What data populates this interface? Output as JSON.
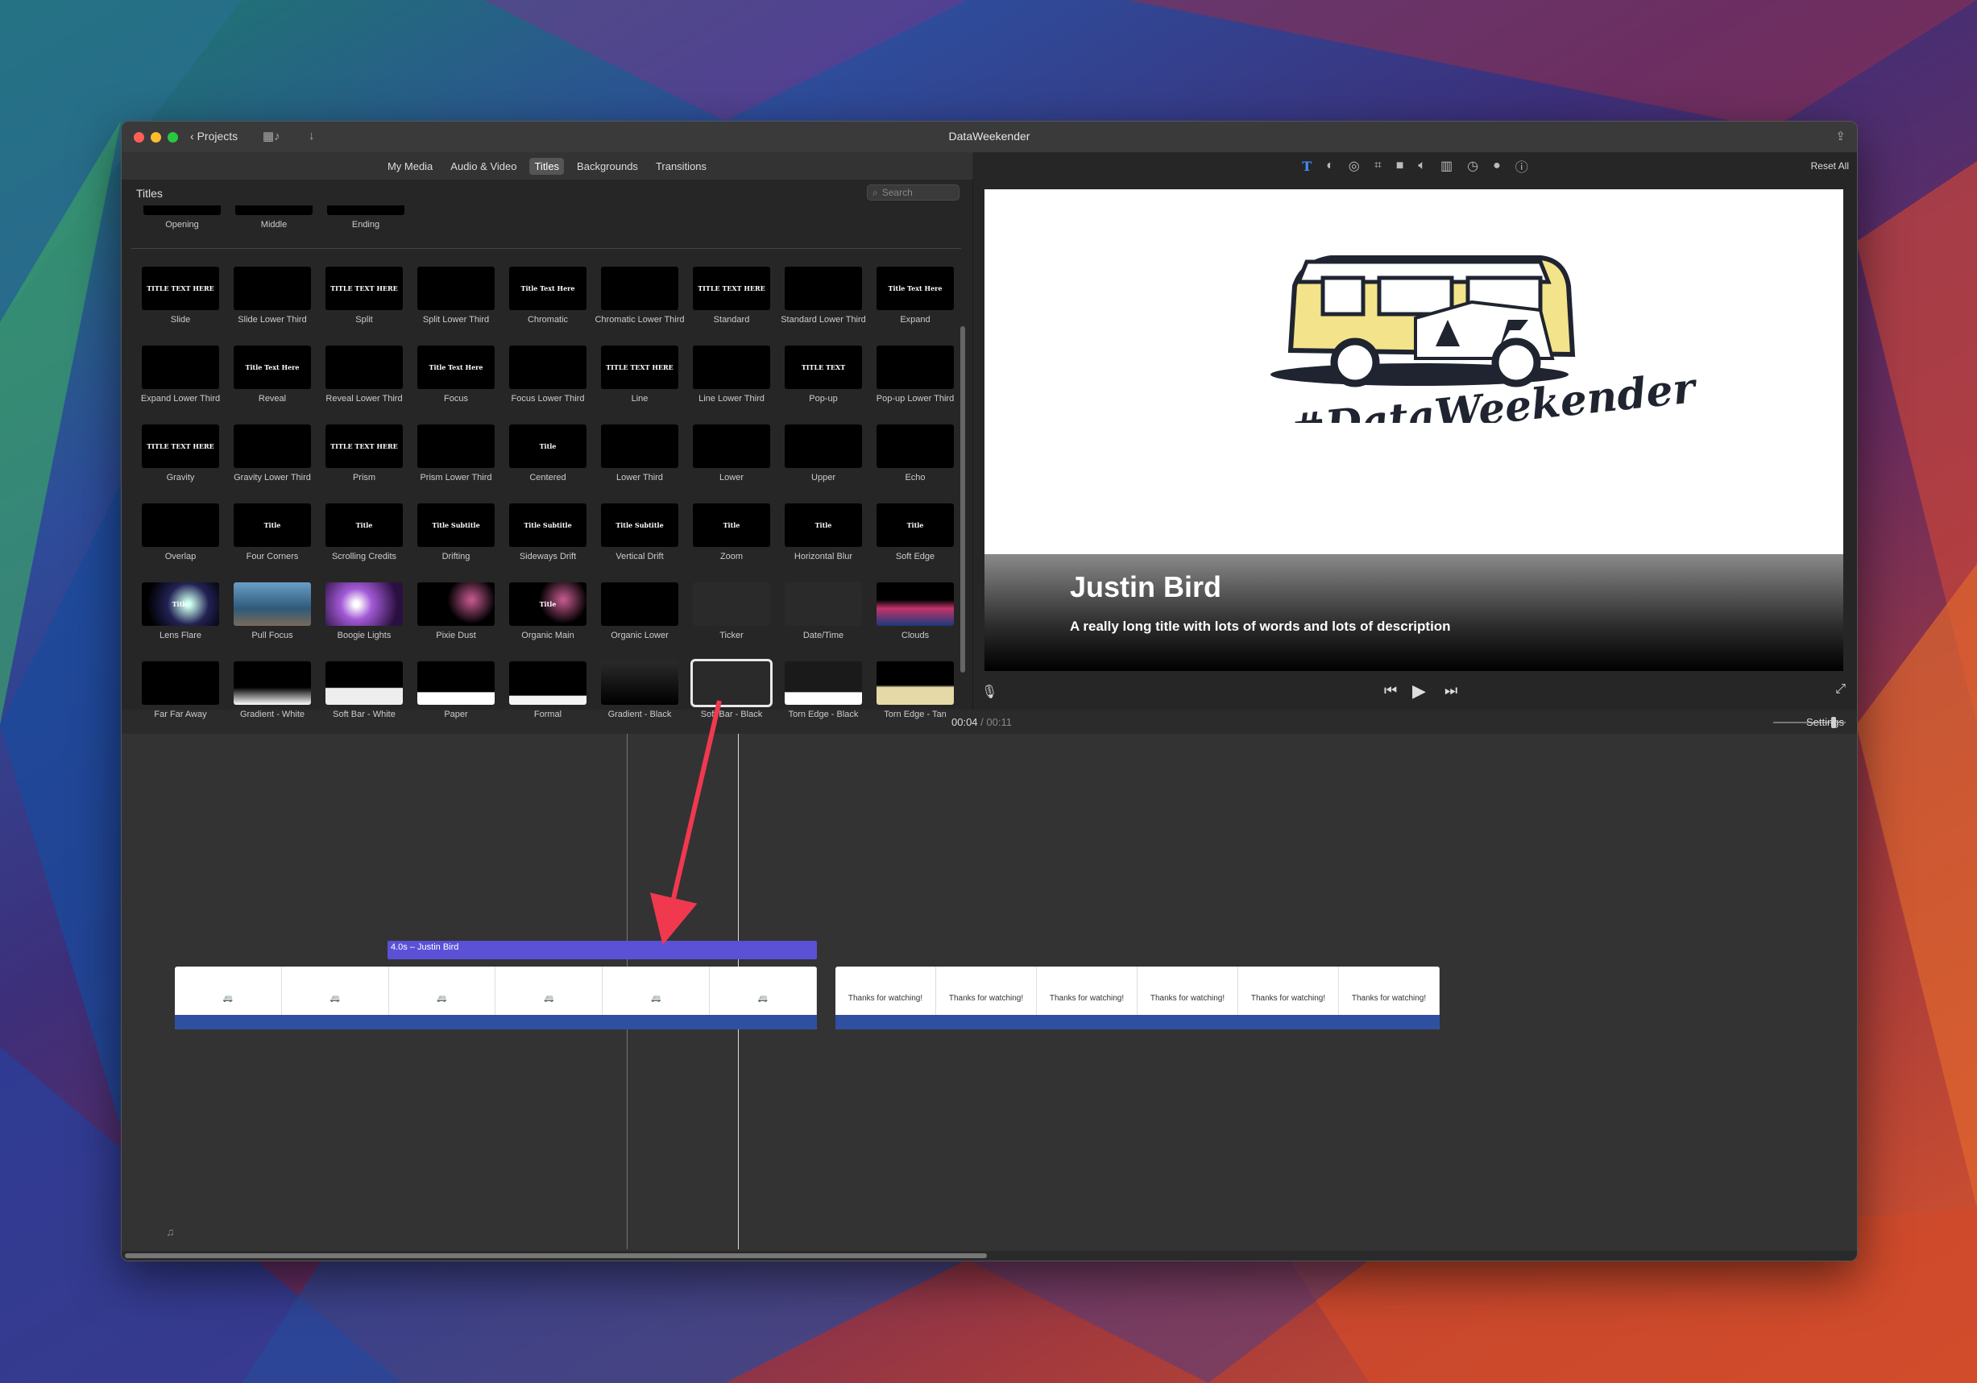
{
  "window": {
    "title": "DataWeekender",
    "back_label": "Projects"
  },
  "tabs": [
    {
      "label": "My Media",
      "active": false
    },
    {
      "label": "Audio & Video",
      "active": false
    },
    {
      "label": "Titles",
      "active": true
    },
    {
      "label": "Backgrounds",
      "active": false
    },
    {
      "label": "Transitions",
      "active": false
    }
  ],
  "browser": {
    "title": "Titles",
    "search_placeholder": "Search",
    "top_categories": [
      "Opening",
      "Middle",
      "Ending"
    ],
    "tiles": [
      {
        "label": "Slide",
        "thumb": "TITLE TEXT HERE"
      },
      {
        "label": "Slide Lower Third",
        "thumb": ""
      },
      {
        "label": "Split",
        "thumb": "TITLE TEXT HERE"
      },
      {
        "label": "Split Lower Third",
        "thumb": ""
      },
      {
        "label": "Chromatic",
        "thumb": "Title Text Here"
      },
      {
        "label": "Chromatic Lower Third",
        "thumb": ""
      },
      {
        "label": "Standard",
        "thumb": "TITLE TEXT HERE"
      },
      {
        "label": "Standard Lower Third",
        "thumb": ""
      },
      {
        "label": "Expand",
        "thumb": "Title Text Here"
      },
      {
        "label": "Expand Lower Third",
        "thumb": ""
      },
      {
        "label": "Reveal",
        "thumb": "Title Text Here"
      },
      {
        "label": "Reveal Lower Third",
        "thumb": ""
      },
      {
        "label": "Focus",
        "thumb": "Title Text Here"
      },
      {
        "label": "Focus Lower Third",
        "thumb": ""
      },
      {
        "label": "Line",
        "thumb": "TITLE TEXT HERE"
      },
      {
        "label": "Line Lower Third",
        "thumb": ""
      },
      {
        "label": "Pop-up",
        "thumb": "TITLE TEXT"
      },
      {
        "label": "Pop-up Lower Third",
        "thumb": ""
      },
      {
        "label": "Gravity",
        "thumb": "TITLE TEXT HERE"
      },
      {
        "label": "Gravity Lower Third",
        "thumb": ""
      },
      {
        "label": "Prism",
        "thumb": "TITLE TEXT HERE"
      },
      {
        "label": "Prism Lower Third",
        "thumb": ""
      },
      {
        "label": "Centered",
        "thumb": "Title"
      },
      {
        "label": "Lower Third",
        "thumb": ""
      },
      {
        "label": "Lower",
        "thumb": ""
      },
      {
        "label": "Upper",
        "thumb": ""
      },
      {
        "label": "Echo",
        "thumb": ""
      },
      {
        "label": "Overlap",
        "thumb": ""
      },
      {
        "label": "Four Corners",
        "thumb": "Title"
      },
      {
        "label": "Scrolling Credits",
        "thumb": "Title"
      },
      {
        "label": "Drifting",
        "thumb": "Title Subtitle"
      },
      {
        "label": "Sideways Drift",
        "thumb": "Title Subtitle"
      },
      {
        "label": "Vertical Drift",
        "thumb": "Title Subtitle"
      },
      {
        "label": "Zoom",
        "thumb": "Title"
      },
      {
        "label": "Horizontal Blur",
        "thumb": "Title"
      },
      {
        "label": "Soft Edge",
        "thumb": "Title"
      },
      {
        "label": "Lens Flare",
        "thumb": "Title"
      },
      {
        "label": "Pull Focus",
        "thumb": ""
      },
      {
        "label": "Boogie Lights",
        "thumb": ""
      },
      {
        "label": "Pixie Dust",
        "thumb": ""
      },
      {
        "label": "Organic Main",
        "thumb": "Title"
      },
      {
        "label": "Organic Lower",
        "thumb": ""
      },
      {
        "label": "Ticker",
        "thumb": ""
      },
      {
        "label": "Date/Time",
        "thumb": ""
      },
      {
        "label": "Clouds",
        "thumb": ""
      },
      {
        "label": "Far Far Away",
        "thumb": ""
      },
      {
        "label": "Gradient - White",
        "thumb": ""
      },
      {
        "label": "Soft Bar - White",
        "thumb": ""
      },
      {
        "label": "Paper",
        "thumb": ""
      },
      {
        "label": "Formal",
        "thumb": ""
      },
      {
        "label": "Gradient - Black",
        "thumb": ""
      },
      {
        "label": "Soft Bar - Black",
        "thumb": "",
        "selected": true
      },
      {
        "label": "Torn Edge - Black",
        "thumb": ""
      },
      {
        "label": "Torn Edge - Tan",
        "thumb": ""
      }
    ]
  },
  "viewer": {
    "reset_label": "Reset All",
    "logo_text": "#DataWeekender",
    "lower_third_name": "Justin Bird",
    "lower_third_desc": "A really long title with lots of words and lots of description"
  },
  "timecode": {
    "current": "00:04",
    "separator": "/",
    "duration": "00:11"
  },
  "settings_label": "Settings",
  "timeline": {
    "title_clip_label": "4.0s – Justin Bird",
    "second_clip_frame_text": "Thanks for watching!"
  },
  "colors": {
    "title_clip": "#5a51d6",
    "audio_track": "#2f4fa0",
    "accent_arrow": "#f0384f"
  }
}
